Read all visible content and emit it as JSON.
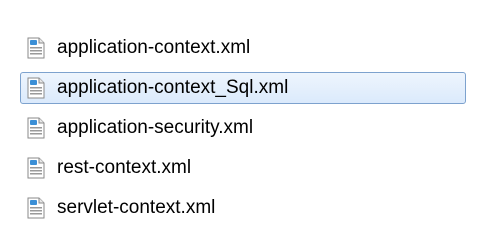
{
  "file_list": {
    "items": [
      {
        "name": "application-context.xml",
        "icon": "xml-file-icon",
        "selected": false
      },
      {
        "name": "application-context_Sql.xml",
        "icon": "xml-file-icon",
        "selected": true
      },
      {
        "name": "application-security.xml",
        "icon": "xml-file-icon",
        "selected": false
      },
      {
        "name": "rest-context.xml",
        "icon": "xml-file-icon",
        "selected": false
      },
      {
        "name": "servlet-context.xml",
        "icon": "xml-file-icon",
        "selected": false
      }
    ]
  },
  "colors": {
    "selection_background": "#dbeafc",
    "selection_border": "#7da2ce",
    "icon_accent": "#3b8fd6"
  }
}
